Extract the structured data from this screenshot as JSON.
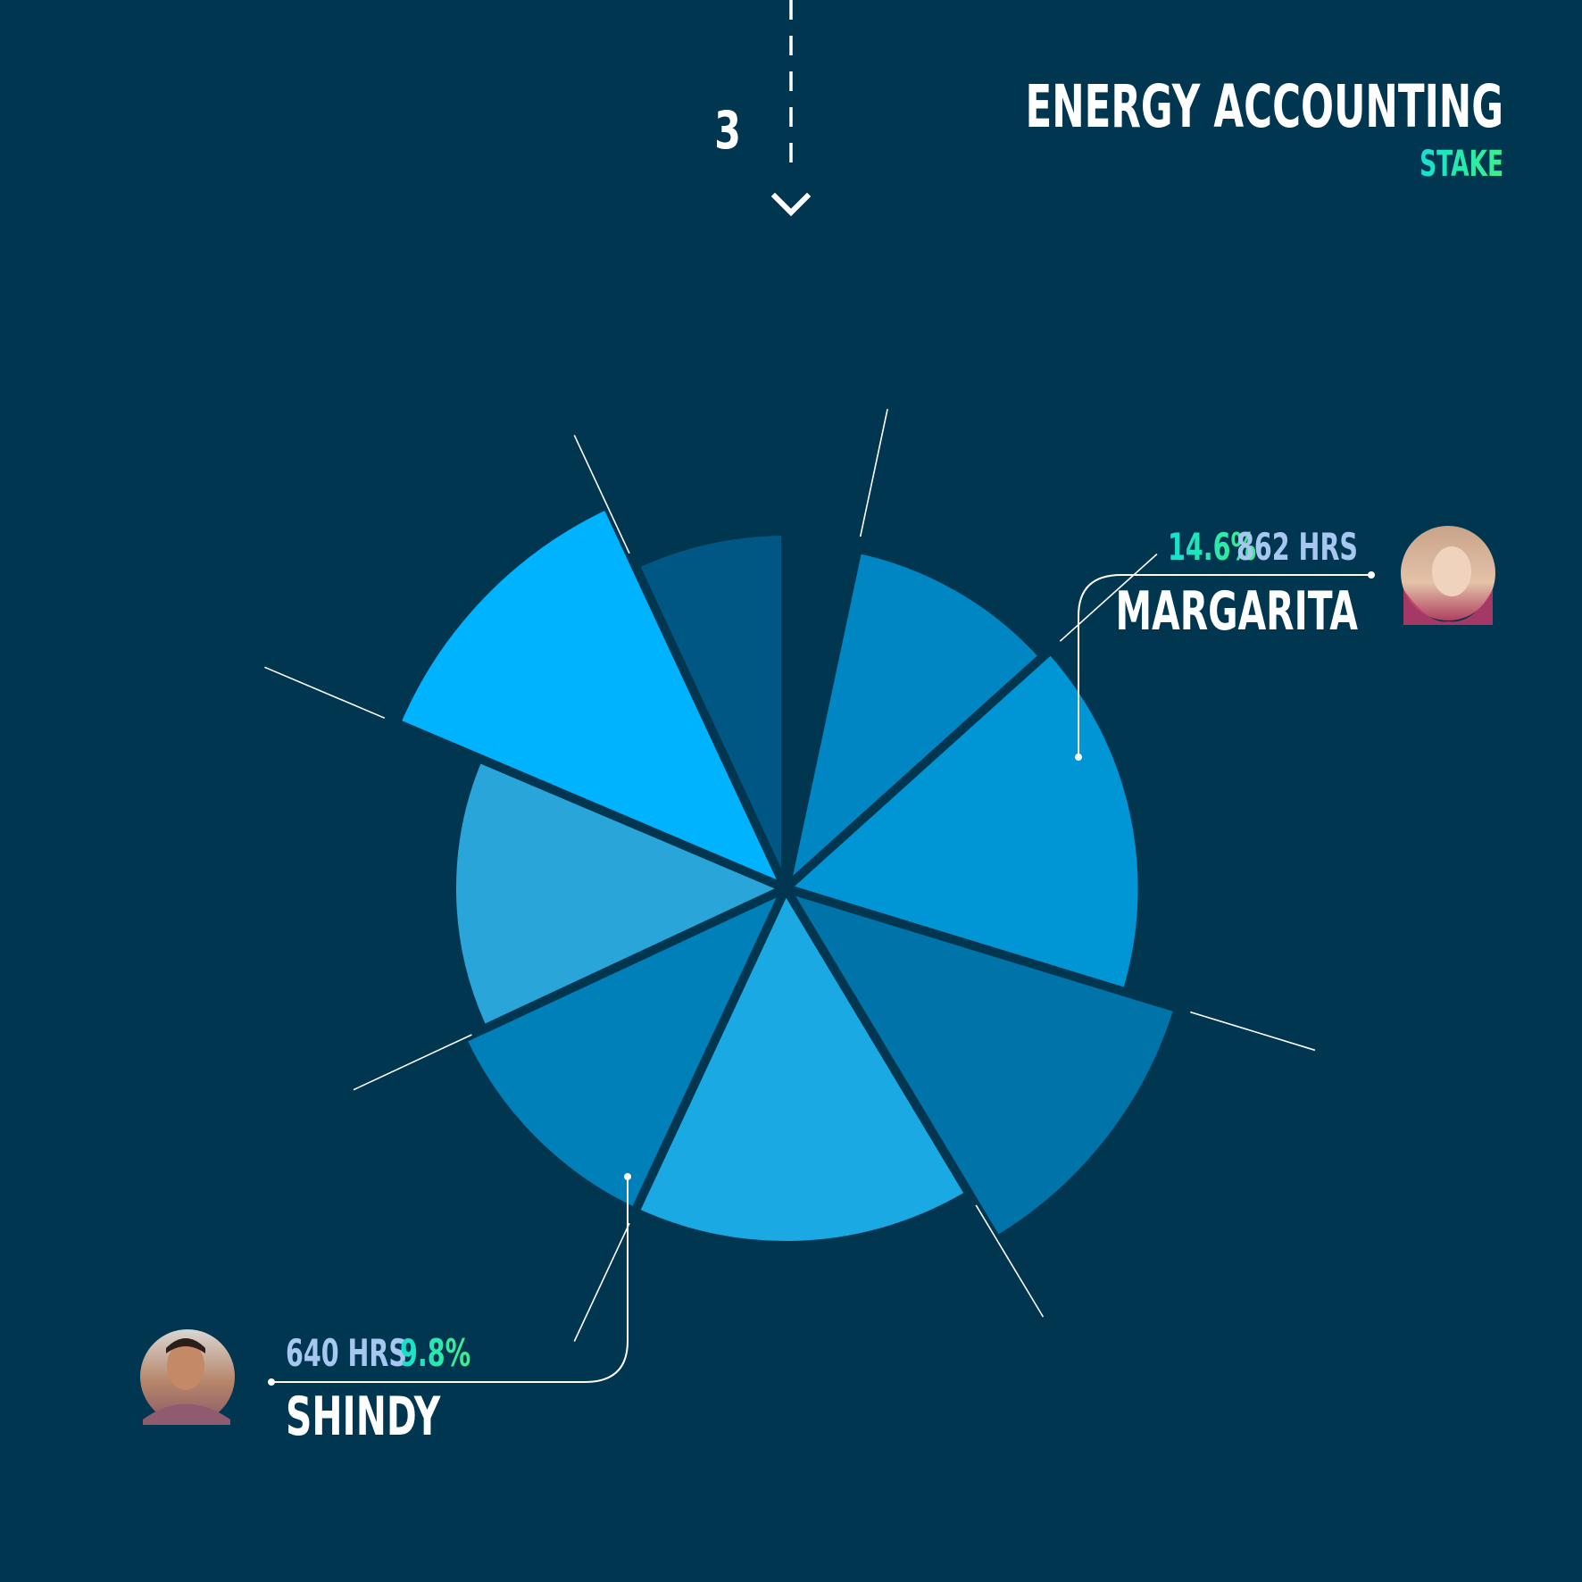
{
  "header": {
    "title": "ENERGY ACCOUNTING",
    "subtitle": "STAKE",
    "step_number": "3"
  },
  "colors": {
    "background": "#013651",
    "accent_teal": "#13e0d2",
    "accent_green": "#3ef08a",
    "hours_text": "#a6c8f0",
    "leader_line": "#ffffff"
  },
  "chart_data": {
    "type": "polar-area",
    "slices": [
      {
        "start_deg": 0,
        "end_deg": 36,
        "radius": 0.972,
        "color": "#0087c3"
      },
      {
        "start_deg": 36,
        "end_deg": 95,
        "radius": 0.999,
        "color": "#0096d6"
      },
      {
        "start_deg": 95,
        "end_deg": 137,
        "radius": 1.15,
        "color": "#0074a9"
      },
      {
        "start_deg": 137,
        "end_deg": 193,
        "radius": 1.0,
        "color": "#1aa9e3"
      },
      {
        "start_deg": 193,
        "end_deg": 233,
        "radius": 1.0,
        "color": "#0080b8"
      },
      {
        "start_deg": 233,
        "end_deg": 281,
        "radius": 0.935,
        "color": "#29a5d9"
      },
      {
        "start_deg": 281,
        "end_deg": 323,
        "radius": 1.185,
        "color": "#00b3ff"
      },
      {
        "start_deg": 323,
        "end_deg": 348,
        "radius": 1.0,
        "color": "#005783"
      }
    ],
    "callouts": [
      {
        "name": "MARGARITA",
        "percent": "14.6%",
        "hours": "862 HRS",
        "avatar": "avatar-photo-icon",
        "slice_index": 1
      },
      {
        "name": "SHINDY",
        "percent": "9.8%",
        "hours": "640 HRS",
        "avatar": "avatar-photo-icon",
        "slice_index": 4
      }
    ]
  }
}
